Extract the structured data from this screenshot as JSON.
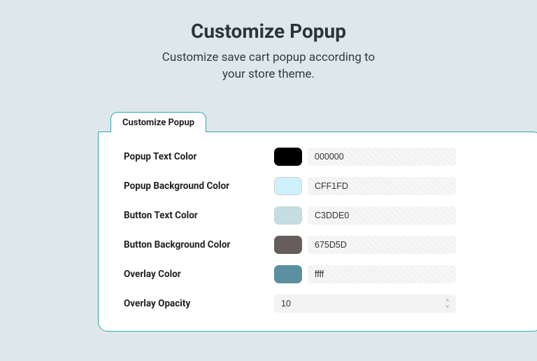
{
  "hero": {
    "title": "Customize Popup",
    "subtitle": "Customize save cart popup according to your store theme."
  },
  "tab": {
    "label": "Customize Popup"
  },
  "fields": {
    "popup_text_color": {
      "label": "Popup Text Color",
      "value": "000000",
      "swatch": "#000000"
    },
    "popup_bg_color": {
      "label": "Popup Background Color",
      "value": "CFF1FD",
      "swatch": "#CFF1FD"
    },
    "button_text_color": {
      "label": "Button Text Color",
      "value": "C3DDE0",
      "swatch": "#C3DDE0"
    },
    "button_bg_color": {
      "label": "Button Background Color",
      "value": "675D5D",
      "swatch": "#675D5D"
    },
    "overlay_color": {
      "label": "Overlay Color",
      "value": "ffff",
      "swatch": "#5b90a1"
    },
    "overlay_opacity": {
      "label": "Overlay Opacity",
      "value": "10"
    }
  }
}
